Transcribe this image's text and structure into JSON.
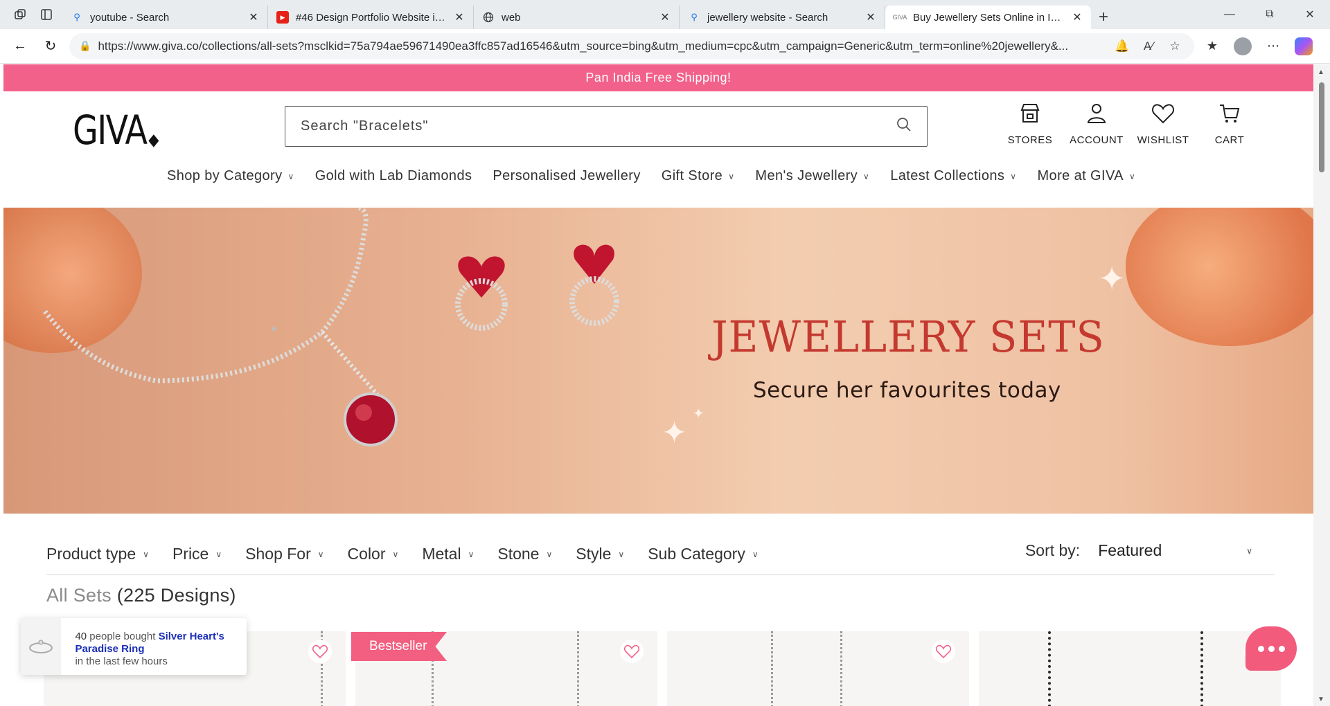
{
  "browser": {
    "tabs": [
      {
        "title": "youtube - Search",
        "favicon": "search-icon",
        "active": false
      },
      {
        "title": "#46 Design Portfolio Website in HTML CSS",
        "favicon": "youtube-icon",
        "active": false
      },
      {
        "title": "web",
        "favicon": "globe-icon",
        "active": false
      },
      {
        "title": "jewellery website - Search",
        "favicon": "search-icon",
        "active": false
      },
      {
        "title": "Buy Jewellery Sets Online in India",
        "favicon": "giva-favicon",
        "active": true
      }
    ],
    "url": "https://www.giva.co/collections/all-sets?msclkid=75a794ae59671490ea3ffc857ad16546&utm_source=bing&utm_medium=cpc&utm_campaign=Generic&utm_term=online%20jewellery&..."
  },
  "promo": {
    "text": "Pan India Free Shipping!"
  },
  "header": {
    "logo": "GIVA",
    "search_placeholder": "Search \"Bracelets\"",
    "icons": [
      {
        "label": "STORES",
        "icon": "store-icon"
      },
      {
        "label": "ACCOUNT",
        "icon": "account-icon"
      },
      {
        "label": "WISHLIST",
        "icon": "heart-icon"
      },
      {
        "label": "CART",
        "icon": "cart-icon"
      }
    ],
    "menu": [
      {
        "label": "Shop by Category",
        "dropdown": true
      },
      {
        "label": "Gold with Lab Diamonds",
        "dropdown": false
      },
      {
        "label": "Personalised Jewellery",
        "dropdown": false
      },
      {
        "label": "Gift Store",
        "dropdown": true
      },
      {
        "label": "Men's Jewellery",
        "dropdown": true
      },
      {
        "label": "Latest Collections",
        "dropdown": true
      },
      {
        "label": "More at GIVA",
        "dropdown": true
      }
    ]
  },
  "banner": {
    "title": "JEWELLERY SETS",
    "subtitle": "Secure her favourites today"
  },
  "filters": {
    "items": [
      "Product type",
      "Price",
      "Shop For",
      "Color",
      "Metal",
      "Stone",
      "Style",
      "Sub Category"
    ],
    "sort_label": "Sort by:",
    "sort_value": "Featured"
  },
  "collection": {
    "title": "All Sets",
    "count": "(225 Designs)"
  },
  "badges": {
    "bestseller": "Bestseller"
  },
  "toast": {
    "count": "40",
    "text_before": " people bought ",
    "product": "Silver Heart's Paradise Ring",
    "text_after": "in the last few hours"
  },
  "colors": {
    "brand_pink": "#f2618a",
    "banner_title": "#c4392f",
    "toast_link": "#1b2fb8"
  }
}
